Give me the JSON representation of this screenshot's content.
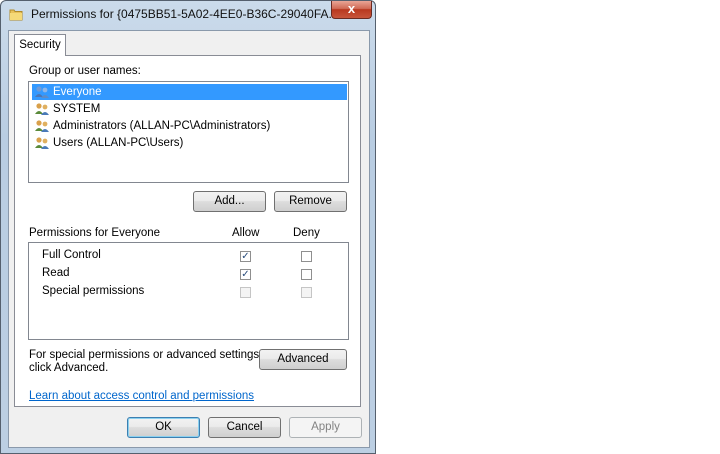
{
  "window": {
    "title": "Permissions for {0475BB51-5A02-4EE0-B36C-29040FA...",
    "close_glyph": "x"
  },
  "tabs": [
    {
      "label": "Security"
    }
  ],
  "group_label": "Group or user names:",
  "users": [
    {
      "name": "Everyone",
      "selected": true
    },
    {
      "name": "SYSTEM",
      "selected": false
    },
    {
      "name": "Administrators (ALLAN-PC\\Administrators)",
      "selected": false
    },
    {
      "name": "Users (ALLAN-PC\\Users)",
      "selected": false
    }
  ],
  "buttons": {
    "add": "Add...",
    "remove": "Remove",
    "advanced": "Advanced",
    "ok": "OK",
    "cancel": "Cancel",
    "apply": "Apply"
  },
  "permissions": {
    "header": "Permissions for Everyone",
    "allow_col": "Allow",
    "deny_col": "Deny",
    "rows": [
      {
        "name": "Full Control",
        "allow": true,
        "deny": false,
        "enabled": true
      },
      {
        "name": "Read",
        "allow": true,
        "deny": false,
        "enabled": true
      },
      {
        "name": "Special permissions",
        "allow": false,
        "deny": false,
        "enabled": false
      }
    ]
  },
  "advanced_text_line1": "For special permissions or advanced settings,",
  "advanced_text_line2": "click Advanced.",
  "learn_link": "Learn about access control and permissions",
  "colors": {
    "selection": "#3399ff",
    "link": "#0066cc"
  }
}
